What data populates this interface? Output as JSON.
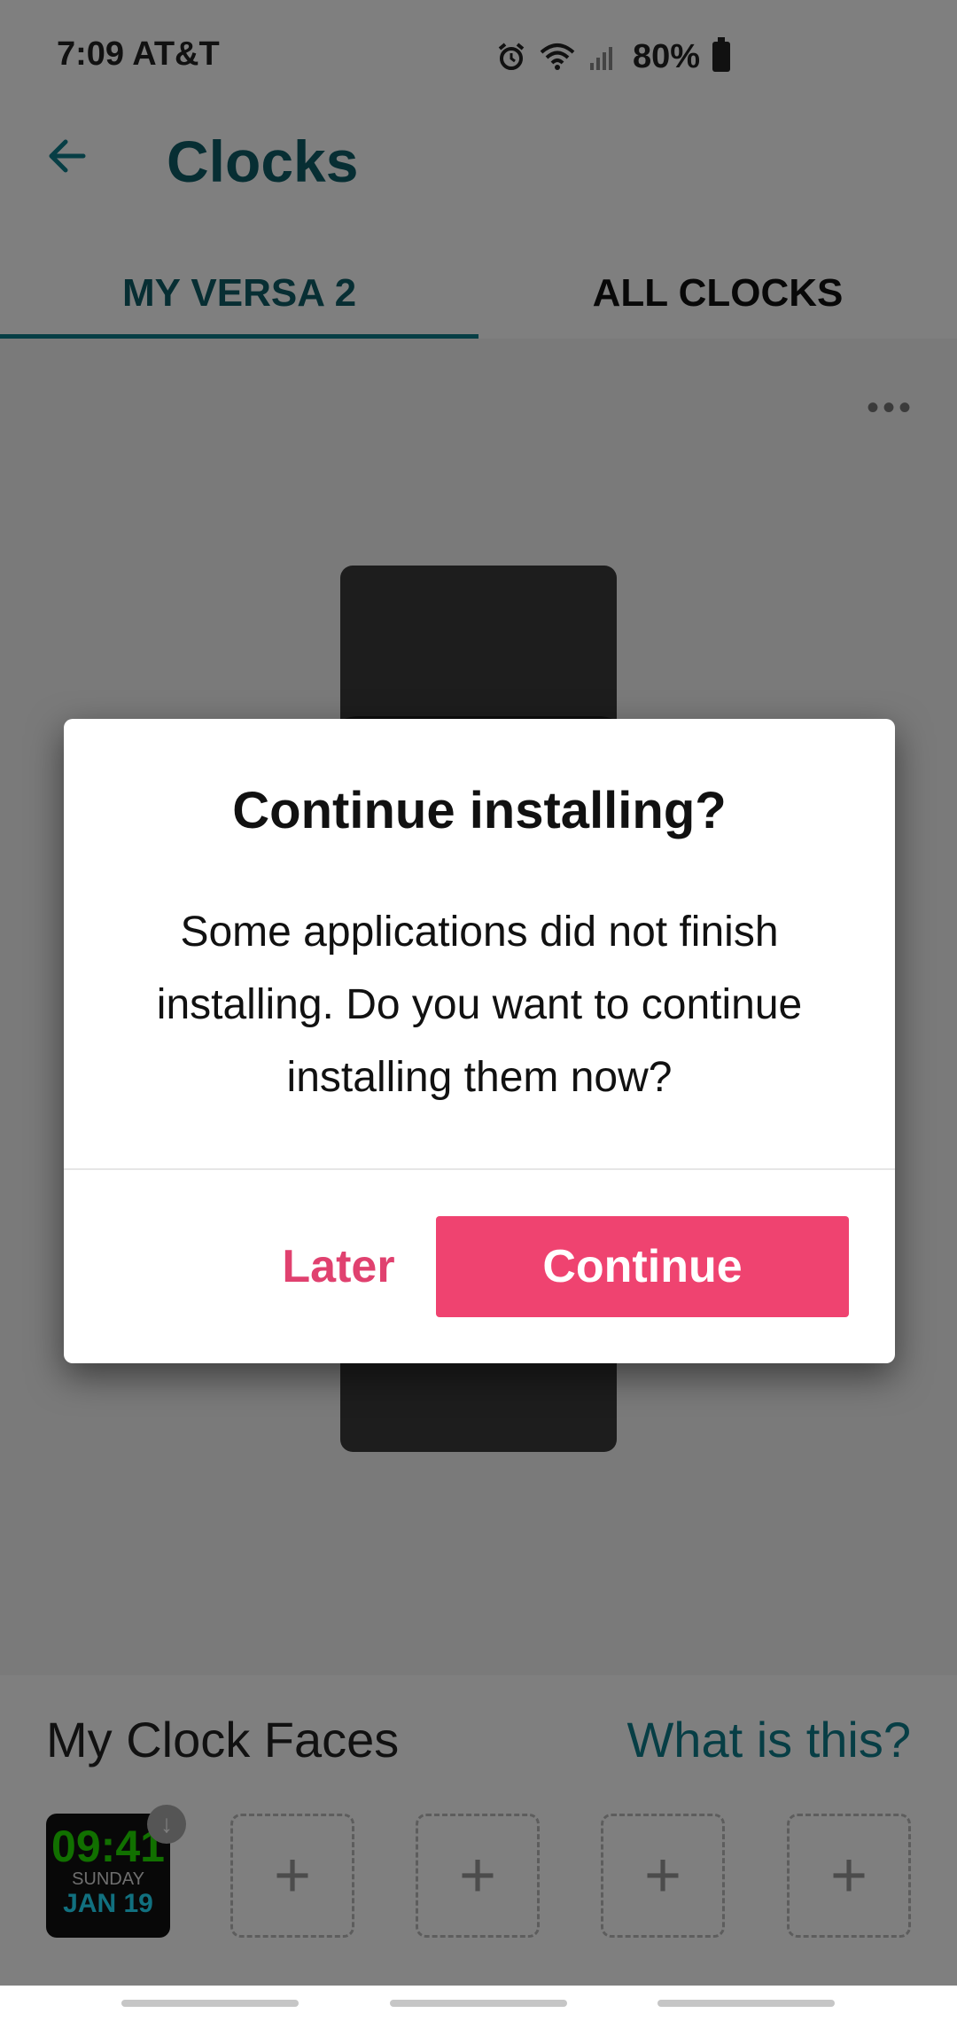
{
  "status_bar": {
    "time_carrier": "7:09 AT&T",
    "battery": "80%",
    "icons": [
      "alarm-icon",
      "wifi-icon",
      "signal-icon",
      "battery-icon"
    ]
  },
  "header": {
    "back_icon": "arrow-left-icon",
    "title": "Clocks"
  },
  "tabs": [
    {
      "label": "MY VERSA 2",
      "active": true
    },
    {
      "label": "ALL CLOCKS",
      "active": false
    }
  ],
  "content": {
    "more_icon": "more-horizontal-icon",
    "more_glyph": "•••"
  },
  "clock_faces": {
    "label": "My Clock Faces",
    "help_link": "What is this?",
    "installed": {
      "time": "09:41",
      "day": "SUNDAY",
      "date": "JAN 19",
      "badge_icon": "download-icon"
    },
    "empty_slot_symbol": "+"
  },
  "dialog": {
    "title": "Continue installing?",
    "body": "Some applications did not finish installing. Do you want to continue installing them now?",
    "later_label": "Later",
    "continue_label": "Continue"
  },
  "colors": {
    "accent_teal": "#0e7c8a",
    "accent_pink": "#ef4370"
  }
}
